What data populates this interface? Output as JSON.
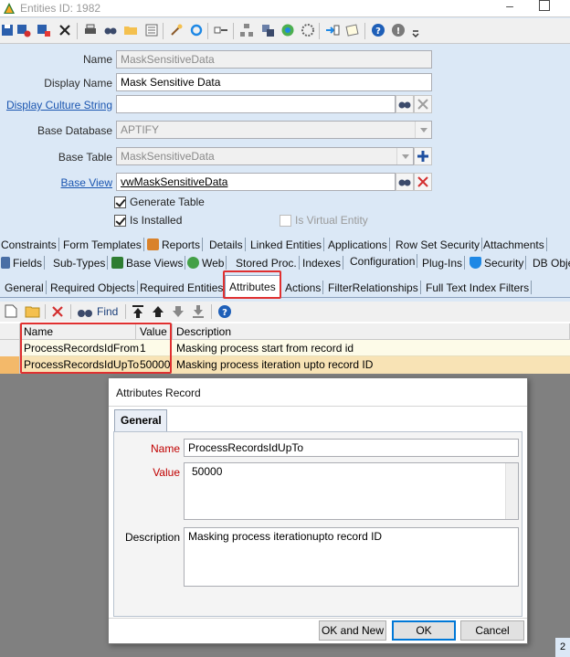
{
  "window": {
    "title": "Entities ID: 1982",
    "minimize": "–"
  },
  "form": {
    "name_label": "Name",
    "name_value": "MaskSensitiveData",
    "display_name_label": "Display Name",
    "display_name_value": "Mask Sensitive Data",
    "display_culture_label": "Display Culture String",
    "display_culture_value": "",
    "base_database_label": "Base Database",
    "base_database_value": "APTIFY",
    "base_table_label": "Base Table",
    "base_table_value": "MaskSensitiveData",
    "base_view_label": "Base View",
    "base_view_value": "vwMaskSensitiveData",
    "generate_table_label": "Generate Table",
    "generate_table_checked": true,
    "is_installed_label": "Is Installed",
    "is_installed_checked": true,
    "is_virtual_label": "Is Virtual Entity",
    "is_virtual_checked": false
  },
  "tabs_row1": [
    "Constraints",
    "Form Templates",
    "Reports",
    "Details",
    "Linked Entities",
    "Applications",
    "Row Set Security",
    "Attachments"
  ],
  "tabs_row2": [
    "Fields",
    "Sub-Types",
    "Base Views",
    "Web",
    "Stored Proc.",
    "Indexes",
    "Configuration",
    "Plug-Ins",
    "Security",
    "DB Obje"
  ],
  "tabs_row3": [
    "General",
    "Required Objects",
    "Required Entities",
    "Attributes",
    "Actions",
    "FilterRelationships",
    "Full Text Index Filters"
  ],
  "inner_toolbar": {
    "find_label": "Find"
  },
  "grid": {
    "columns": [
      "Name",
      "Value",
      "Description"
    ],
    "rows": [
      {
        "name": "ProcessRecordsIdFrom",
        "value": "1",
        "description": "Masking process start from  record id"
      },
      {
        "name": "ProcessRecordsIdUpTo",
        "value": "50000",
        "description": "Masking process iteration upto record ID"
      }
    ]
  },
  "dialog": {
    "title": "Attributes Record",
    "tab": "General",
    "name_label": "Name",
    "name_value": "ProcessRecordsIdUpTo",
    "value_label": "Value",
    "value_value": "50000",
    "description_label": "Description",
    "description_value": "Masking process iterationupto record ID",
    "ok_and_new": "OK and New",
    "ok": "OK",
    "cancel": "Cancel"
  },
  "status": {
    "page": "2"
  },
  "colors": {
    "highlight": "#e03030",
    "row_selected": "#f8e3b5",
    "row_normal": "#fdfbe8",
    "panel_bg": "#dbe8f6"
  }
}
